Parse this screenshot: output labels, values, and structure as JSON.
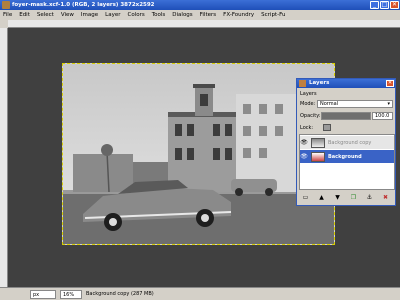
{
  "window": {
    "title": "foyer-mask.xcf-1.0 (RGB, 2 layers) 3872x2592",
    "buttons": {
      "minimize": "_",
      "maximize": "□",
      "close": "✕"
    }
  },
  "menu": {
    "items": [
      "File",
      "Edit",
      "Select",
      "View",
      "Image",
      "Layer",
      "Colors",
      "Tools",
      "Dialogs",
      "Filters",
      "FX-Foundry",
      "Script-Fu"
    ]
  },
  "status": {
    "unit": "px",
    "zoom": "16%",
    "message": "Background copy (287 MB)"
  },
  "layers_panel": {
    "title": "Layers",
    "section_label": "Layers",
    "mode_label": "Mode:",
    "mode_value": "Normal",
    "opacity_label": "Opacity:",
    "opacity_value": "100.0",
    "lock_label": "Lock:",
    "layers": [
      {
        "name": "Background copy",
        "visible": true,
        "selected": true
      },
      {
        "name": "Background",
        "visible": true,
        "selected": false
      }
    ]
  },
  "colors": {
    "titlebar": "#2457c8",
    "selection_marquee": "#d9d000",
    "selected_layer": "#3a63c6"
  }
}
